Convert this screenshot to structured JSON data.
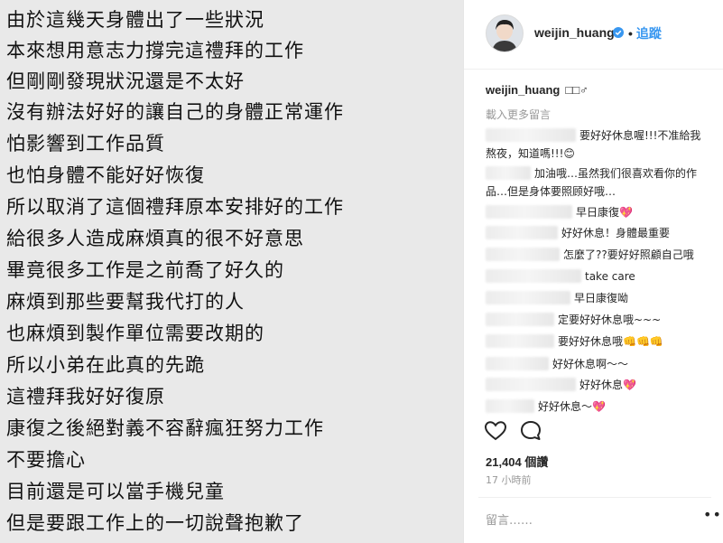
{
  "photo": {
    "lines": [
      "由於這幾天身體出了一些狀況",
      "本來想用意志力撐完這禮拜的工作",
      "但剛剛發現狀況還是不太好",
      "沒有辦法好好的讓自己的身體正常運作",
      "怕影響到工作品質",
      "也怕身體不能好好恢復",
      "所以取消了這個禮拜原本安排好的工作",
      "給很多人造成麻煩真的很不好意思",
      "畢竟很多工作是之前喬了好久的",
      "麻煩到那些要幫我代打的人",
      "也麻煩到製作單位需要改期的",
      "所以小弟在此真的先跪",
      "這禮拜我好好復原",
      "康復之後絕對義不容辭瘋狂努力工作",
      "不要擔心",
      "目前還是可以當手機兒童",
      "但是要跟工作上的一切說聲抱歉了"
    ]
  },
  "header": {
    "username": "weijin_huang",
    "dot": "•",
    "follow_label": "追蹤"
  },
  "caption": {
    "username": "weijin_huang",
    "text": "□□♂"
  },
  "load_more_label": "載入更多留言",
  "comments": [
    {
      "text": "要好好休息喔!!!不准給我"
    },
    {
      "text": "熬夜，知道嗎!!!😊"
    },
    {
      "text": "加油哦…虽然我们很喜欢看你的作"
    },
    {
      "text": "品…但是身体要照顾好哦…"
    },
    {
      "text": "早日康復💖"
    },
    {
      "text": "好好休息！身體最重要"
    },
    {
      "text": "怎麼了??要好好照顧自己哦"
    },
    {
      "text": "take care"
    },
    {
      "text": "早日康復呦"
    },
    {
      "text": "定要好好休息哦~~~"
    },
    {
      "text": "要好好休息哦👊👊👊"
    },
    {
      "text": "好好休息啊～～"
    },
    {
      "text": "好好休息💖"
    },
    {
      "text": "好好休息～💖"
    }
  ],
  "likes_label": "21,404 個讚",
  "time_label": "17 小時前",
  "comment_placeholder": "留言……",
  "more_label": "•••",
  "colors": {
    "accent": "#3897f0",
    "text": "#262626",
    "muted": "#999999",
    "photo_bg": "#e9e9e9"
  },
  "icons": [
    "verified-badge-icon",
    "heart-icon",
    "comment-icon",
    "more-options-icon"
  ]
}
